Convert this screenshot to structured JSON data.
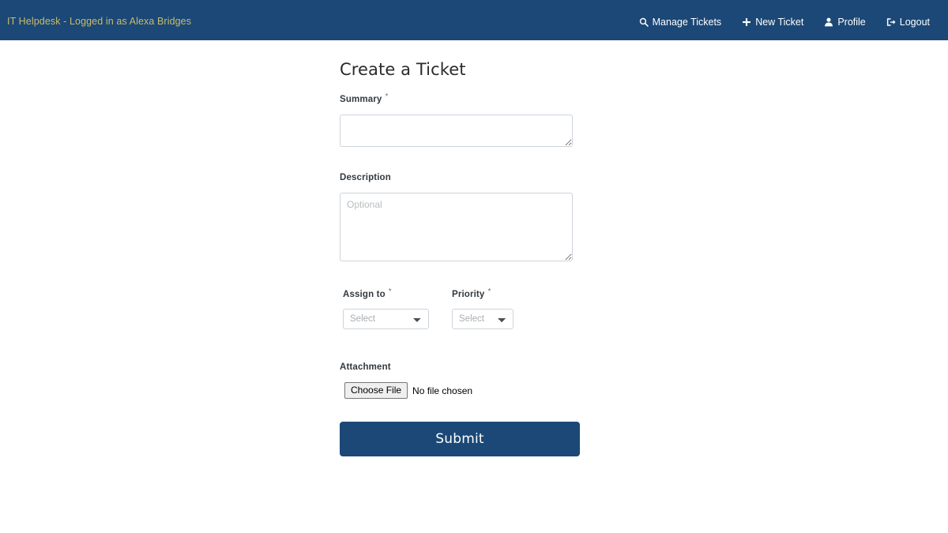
{
  "navbar": {
    "brand": "IT Helpdesk - Logged in as Alexa Bridges",
    "brand_color": "#cbbb6a",
    "background_color": "#1b4876",
    "links": [
      {
        "label": "Manage Tickets",
        "icon": "search-icon"
      },
      {
        "label": "New Ticket",
        "icon": "plus-icon"
      },
      {
        "label": "Profile",
        "icon": "user-icon"
      },
      {
        "label": "Logout",
        "icon": "sign-out-icon"
      }
    ]
  },
  "form": {
    "title": "Create a Ticket",
    "required_marker": "*",
    "summary": {
      "label": "Summary",
      "required": true,
      "value": "",
      "placeholder": ""
    },
    "description": {
      "label": "Description",
      "required": false,
      "value": "",
      "placeholder": "Optional"
    },
    "assign_to": {
      "label": "Assign to",
      "required": true,
      "selected": "Select",
      "options": [
        "Select"
      ]
    },
    "priority": {
      "label": "Priority",
      "required": true,
      "selected": "Select",
      "options": [
        "Select"
      ]
    },
    "attachment": {
      "label": "Attachment",
      "button_label": "Choose File",
      "status": "No file chosen"
    },
    "submit": {
      "label": "Submit",
      "color": "#1b4876"
    }
  }
}
